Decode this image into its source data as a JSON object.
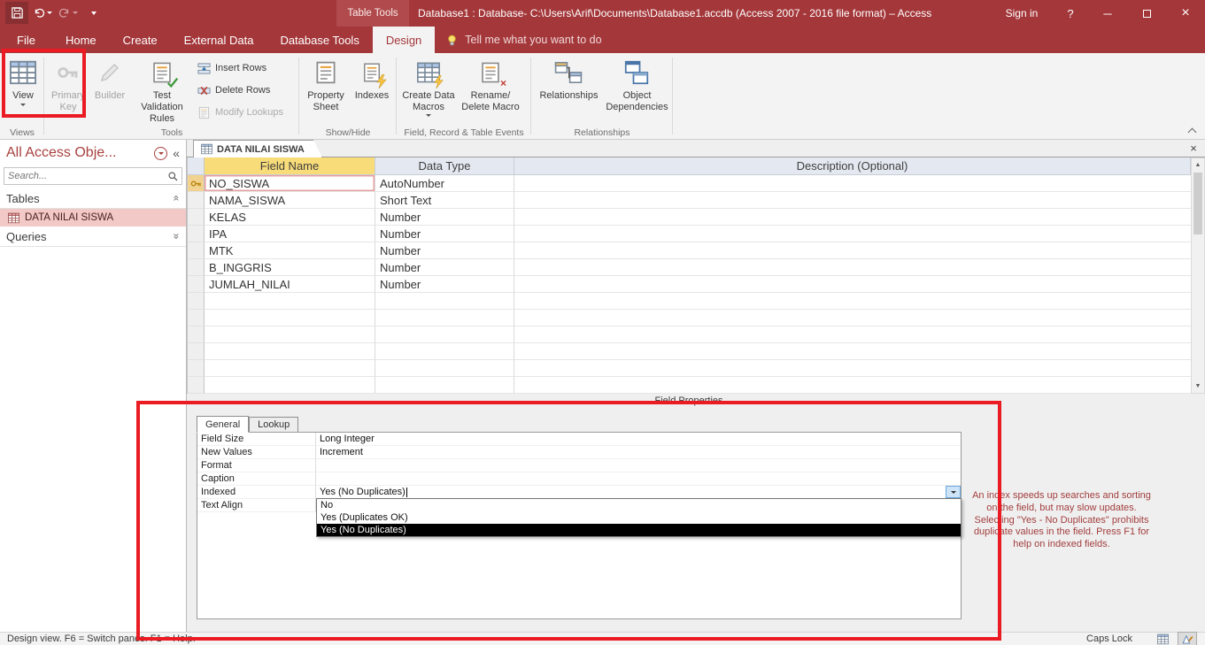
{
  "titlebar": {
    "contextual_tab": "Table Tools",
    "title": "Database1 : Database- C:\\Users\\Arif\\Documents\\Database1.accdb (Access 2007 - 2016 file format)  –  Access",
    "sign_in": "Sign in",
    "help_glyph": "?"
  },
  "ribbon": {
    "tabs": [
      "File",
      "Home",
      "Create",
      "External Data",
      "Database Tools",
      "Design"
    ],
    "active_tab": "Design",
    "tellme": "Tell me what you want to do",
    "views_group": {
      "view": "View",
      "label": "Views"
    },
    "tools_group": {
      "primary_key": "Primary Key",
      "builder": "Builder",
      "test_validation": "Test Validation Rules",
      "insert_rows": "Insert Rows",
      "delete_rows": "Delete Rows",
      "modify_lookups": "Modify Lookups",
      "label": "Tools"
    },
    "showhide_group": {
      "property_sheet": "Property Sheet",
      "indexes": "Indexes",
      "label": "Show/Hide"
    },
    "events_group": {
      "create_data_macros": "Create Data Macros",
      "rename_delete": "Rename/ Delete Macro",
      "label": "Field, Record & Table Events"
    },
    "relationships_group": {
      "relationships": "Relationships",
      "object_dependencies": "Object Dependencies",
      "label": "Relationships"
    }
  },
  "nav": {
    "title": "All Access Obje...",
    "search_placeholder": "Search...",
    "sections": {
      "tables": "Tables",
      "queries": "Queries"
    },
    "table_item": "DATA NILAI SISWA"
  },
  "doc": {
    "tab": "DATA NILAI SISWA",
    "headers": {
      "field_name": "Field Name",
      "data_type": "Data Type",
      "description": "Description (Optional)"
    },
    "fields": [
      {
        "name": "NO_SISWA",
        "type": "AutoNumber"
      },
      {
        "name": "NAMA_SISWA",
        "type": "Short Text"
      },
      {
        "name": "KELAS",
        "type": "Number"
      },
      {
        "name": "IPA",
        "type": "Number"
      },
      {
        "name": "MTK",
        "type": "Number"
      },
      {
        "name": "B_INGGRIS",
        "type": "Number"
      },
      {
        "name": "JUMLAH_NILAI",
        "type": "Number"
      }
    ]
  },
  "properties": {
    "section_label": "Field Properties",
    "tabs": {
      "general": "General",
      "lookup": "Lookup"
    },
    "rows": [
      {
        "label": "Field Size",
        "value": "Long Integer"
      },
      {
        "label": "New Values",
        "value": "Increment"
      },
      {
        "label": "Format",
        "value": ""
      },
      {
        "label": "Caption",
        "value": ""
      },
      {
        "label": "Indexed",
        "value": "Yes (No Duplicates)"
      },
      {
        "label": "Text Align",
        "value": ""
      }
    ],
    "dropdown": {
      "options": [
        "No",
        "Yes (Duplicates OK)",
        "Yes (No Duplicates)"
      ],
      "selected": "Yes (No Duplicates)"
    },
    "help_text": "An index speeds up searches and sorting on the field, but may slow updates. Selecting \"Yes - No Duplicates\" prohibits duplicate values in the field. Press F1 for help on indexed fields."
  },
  "statusbar": {
    "left": "Design view.  F6 = Switch panes.  F1 = Help.",
    "caps_lock": "Caps Lock"
  },
  "colors": {
    "accent": "#A4373A",
    "field_name_header": "#F8DC7A",
    "nav_selection": "#F3C9C7",
    "dropdown_selection": "#000000",
    "annotation": "#EA1B22"
  }
}
